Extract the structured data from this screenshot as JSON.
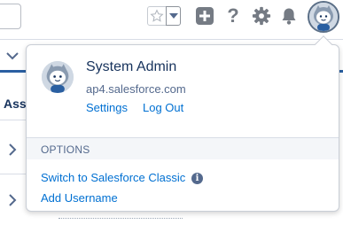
{
  "header": {
    "icons": {
      "favorite": "star-icon",
      "favorites_menu": "caret-down-icon",
      "global_actions": "plus-icon",
      "help": "question-icon",
      "setup": "gear-icon",
      "notifications": "bell-icon",
      "profile": "astro-avatar"
    },
    "help_glyph": "?"
  },
  "page": {
    "heading_partial": "Ass"
  },
  "profile_menu": {
    "user_name": "System Admin",
    "domain": "ap4.salesforce.com",
    "settings_label": "Settings",
    "logout_label": "Log Out",
    "options_heading": "OPTIONS",
    "switch_classic_label": "Switch to Salesforce Classic",
    "info_glyph": "i",
    "add_username_label": "Add Username"
  },
  "colors": {
    "link": "#0070d2",
    "text_primary": "#16325c",
    "text_secondary": "#54698d",
    "icon_gray": "#757b84",
    "nav_accent": "#2a5fa1"
  }
}
